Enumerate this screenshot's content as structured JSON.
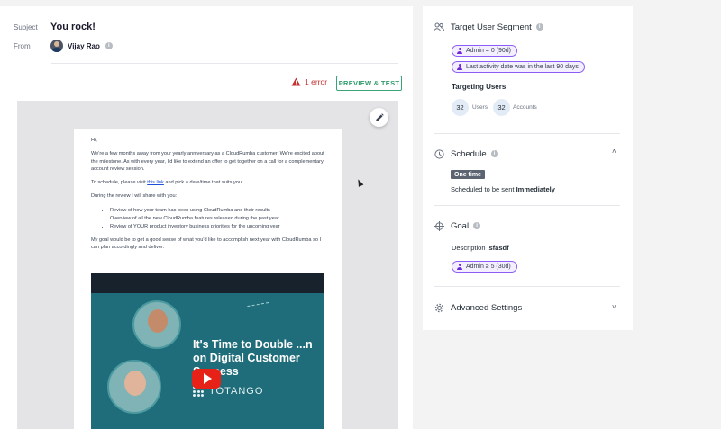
{
  "email_header": {
    "subject_label": "Subject",
    "subject_value": "You rock!",
    "from_label": "From",
    "from_value": "Vijay Rao"
  },
  "toolbar": {
    "error_text": "1 error",
    "preview_label": "PREVIEW & TEST"
  },
  "email_body": {
    "greeting": "Hi,",
    "para1": "We're a few months away from your yearly anniversary as a CloudRumba customer. We're excited about the milestone. As with every year, I'd like to extend an offer to get together on a call for a complementary account review session.",
    "para2_before": "To schedule, please visit ",
    "para2_link": "this link",
    "para2_after": " and pick a date/time that suits you.",
    "para3": "During the review I will share with you:",
    "bullets": [
      "Review of how your team has been using CloudRumba and their results",
      "Overview of all the new CloudRumba features released during the past year",
      "Review of YOUR product inventory business priorities for the upcoming year"
    ],
    "para4": "My goal would be to get a good sense of what you'd like to accomplish next year with CloudRumba so I can plan accordingly and deliver.",
    "video_title": "It's Time to Double ...n on Digital Customer Success",
    "video_brand": "TOTANGO"
  },
  "target_segment": {
    "title": "Target User Segment",
    "chips": [
      "Admin = 0 (90d)",
      "Last activity date was in the last 90 days"
    ],
    "targeting_label": "Targeting Users",
    "users_count": "32",
    "users_label": "Users",
    "accounts_count": "32",
    "accounts_label": "Accounts"
  },
  "schedule": {
    "title": "Schedule",
    "badge": "One time",
    "text_prefix": "Scheduled to be sent ",
    "text_bold": "Immediately"
  },
  "goal": {
    "title": "Goal",
    "description_label": "Description",
    "description_value": "sfasdf",
    "chip": "Admin ≥ 5 (30d)"
  },
  "advanced": {
    "title": "Advanced Settings"
  },
  "colors": {
    "accent_green": "#3ba378",
    "error_red": "#c53030",
    "chip_purple": "#8b5cf6"
  }
}
